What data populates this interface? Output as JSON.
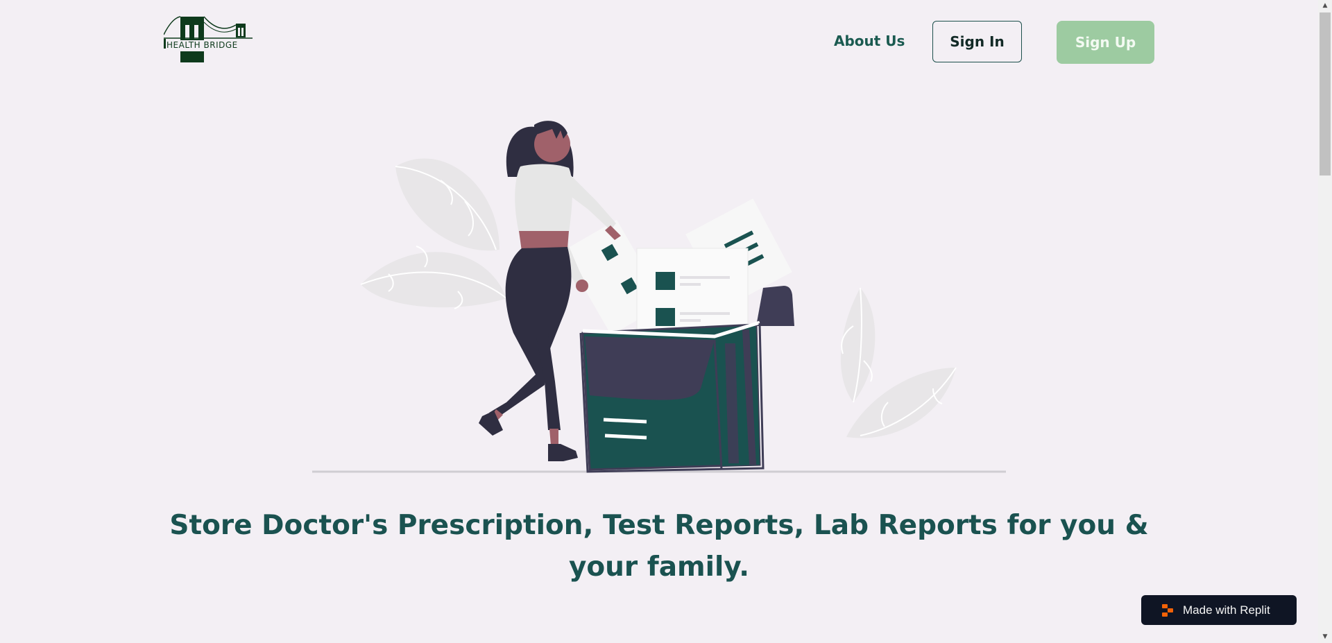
{
  "header": {
    "logo_text": "HEALTH BRIDGE",
    "nav": {
      "about_label": "About Us",
      "signin_label": "Sign In",
      "signup_label": "Sign Up"
    }
  },
  "hero": {
    "headline": "Store Doctor's Prescription, Test Reports, Lab Reports for you & your family."
  },
  "badge": {
    "label": "Made with Replit",
    "icon": "replit-icon"
  },
  "colors": {
    "brand_dark_green": "#1a5250",
    "signup_bg": "#9dcba1",
    "page_bg": "#f3eff4",
    "badge_bg": "#0f1524",
    "replit_orange": "#f26207"
  }
}
